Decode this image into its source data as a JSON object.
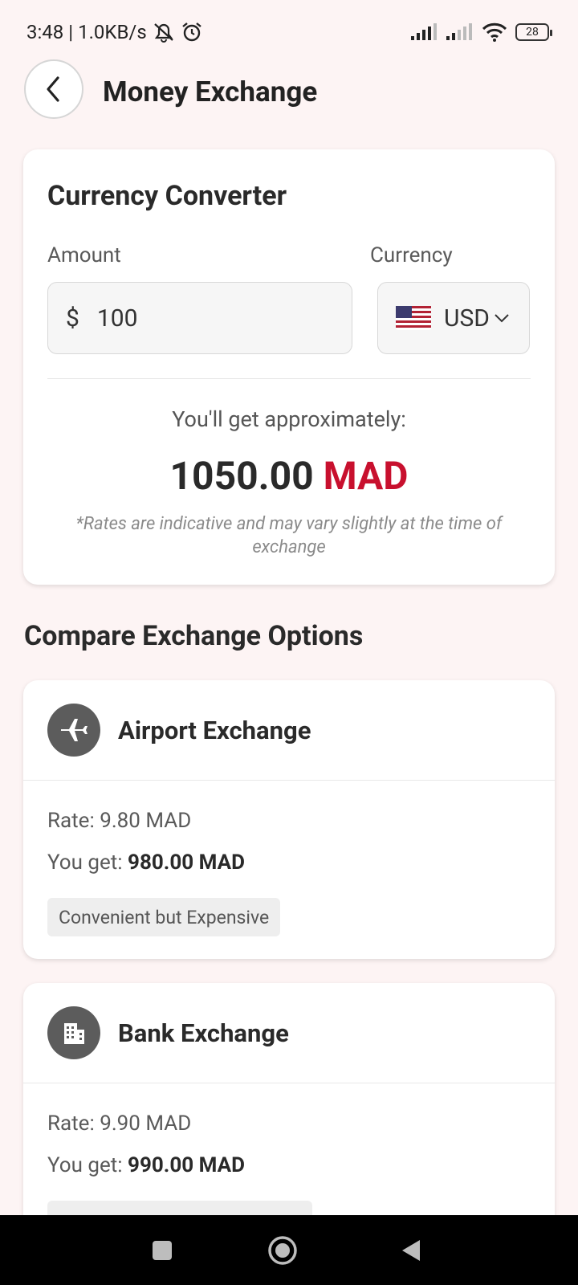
{
  "status": {
    "time": "3:48",
    "network_speed": "| 1.0KB/s",
    "battery": "28"
  },
  "header": {
    "title": "Money Exchange"
  },
  "converter": {
    "title": "Currency Converter",
    "amount_label": "Amount",
    "currency_label": "Currency",
    "amount_symbol": "$",
    "amount_value": "100",
    "currency_code": "USD",
    "currency_flag": "us-flag-icon",
    "approx_label": "You'll get approximately:",
    "result_amount": "1050.00",
    "result_currency": "MAD",
    "disclaimer": "*Rates are indicative and may vary slightly at the time of exchange",
    "accent_color": "#c8102e"
  },
  "compare": {
    "title": "Compare Exchange Options",
    "options": [
      {
        "name": "Airport Exchange",
        "icon": "airplane-icon",
        "rate": "Rate: 9.80 MAD",
        "get_label": "You get: ",
        "get_value": "980.00 MAD",
        "tag": "Convenient but Expensive"
      },
      {
        "name": "Bank Exchange",
        "icon": "bank-building-icon",
        "rate": "Rate: 9.90 MAD",
        "get_label": "You get: ",
        "get_value": "990.00 MAD",
        "tag": ""
      }
    ]
  }
}
